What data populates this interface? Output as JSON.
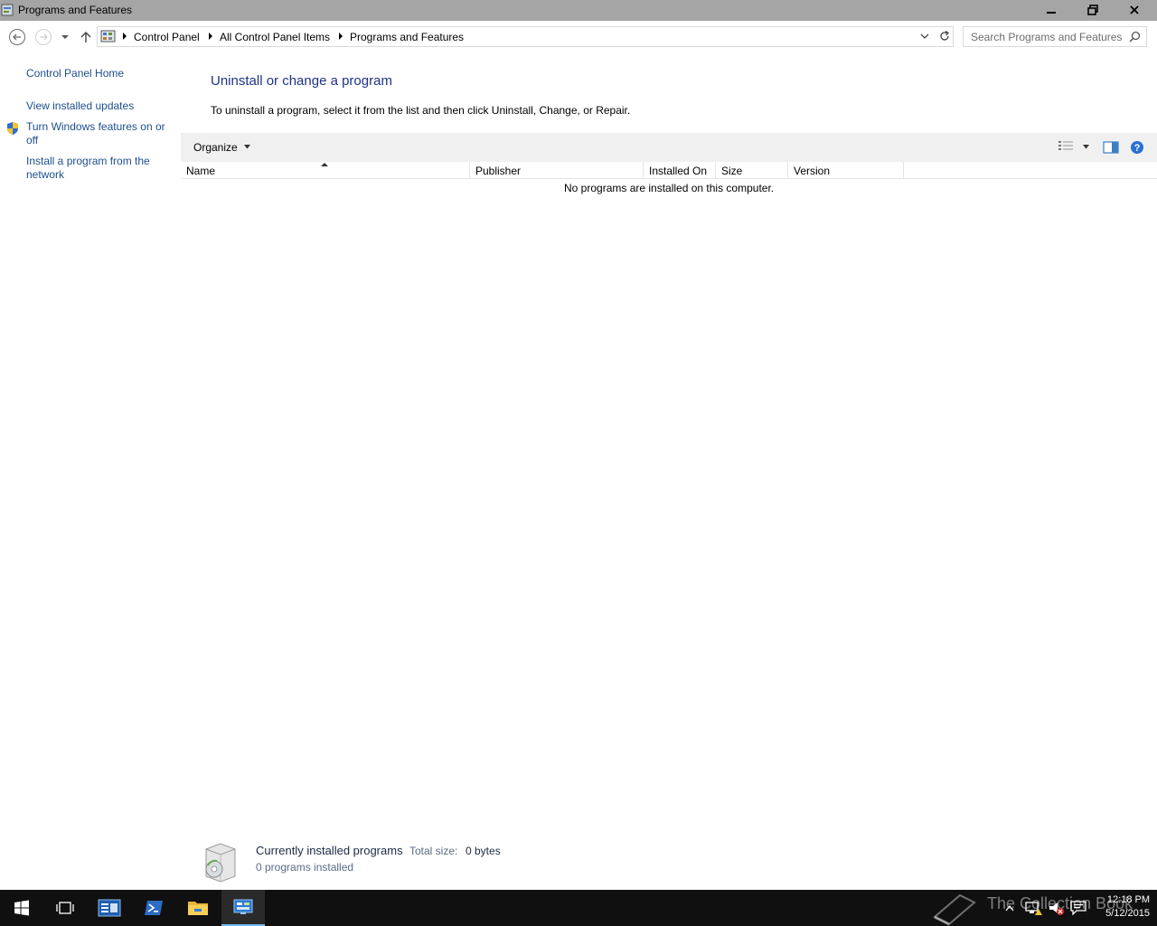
{
  "window": {
    "title": "Programs and Features",
    "controls": {
      "minimize": "minimize-icon",
      "restore": "restore-icon",
      "close": "close-icon"
    }
  },
  "nav": {
    "breadcrumbs": [
      "Control Panel",
      "All Control Panel Items",
      "Programs and Features"
    ],
    "search_placeholder": "Search Programs and Features"
  },
  "left_pane": {
    "home": "Control Panel Home",
    "links": [
      "View installed updates",
      "Turn Windows features on or off",
      "Install a program from the network"
    ]
  },
  "main": {
    "heading": "Uninstall or change a program",
    "instructions": "To uninstall a program, select it from the list and then click Uninstall, Change, or Repair.",
    "organize": "Organize",
    "columns": [
      "Name",
      "Publisher",
      "Installed On",
      "Size",
      "Version"
    ],
    "empty_message": "No programs are installed on this computer."
  },
  "details": {
    "title": "Currently installed programs",
    "total_size_label": "Total size:",
    "total_size_value": "0 bytes",
    "count": "0 programs installed"
  },
  "taskbar": {
    "items": [
      "start-icon",
      "task-view-icon",
      "server-manager-icon",
      "powershell-icon",
      "file-explorer-icon",
      "control-panel-icon"
    ],
    "watermark": "The Collection Book",
    "time": "12:18 PM",
    "date": "5/12/2015"
  },
  "colors": {
    "link": "#1e4e8c",
    "heading": "#1e3287",
    "titlebar": "#a5a5a5",
    "taskbar": "#101010"
  }
}
